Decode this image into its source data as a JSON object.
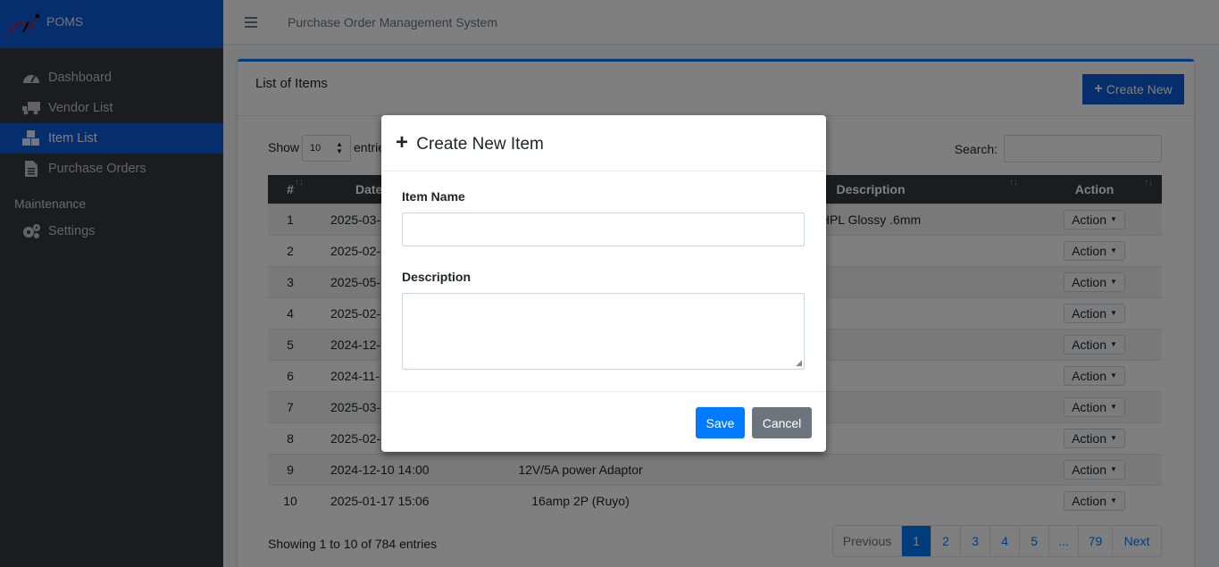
{
  "brand": {
    "name": "POMS"
  },
  "sidebar": {
    "items": [
      {
        "label": "Dashboard",
        "icon": "dashboard-icon"
      },
      {
        "label": "Vendor List",
        "icon": "truck-icon"
      },
      {
        "label": "Item List",
        "icon": "boxes-icon"
      },
      {
        "label": "Purchase Orders",
        "icon": "document-icon"
      }
    ],
    "section_header": "Maintenance",
    "section_items": [
      {
        "label": "Settings",
        "icon": "gears-icon"
      }
    ]
  },
  "header": {
    "title": "Purchase Order Management System"
  },
  "card": {
    "title": "List of Items",
    "create_button": "Create New"
  },
  "controls": {
    "show_label": "Show",
    "entries_value": "10",
    "entries_label": "entries",
    "search_label": "Search:"
  },
  "table": {
    "columns": [
      "#",
      "Date C",
      "Description",
      "Action"
    ],
    "rows": [
      {
        "num": "1",
        "date": "2025-03-",
        "name": "",
        "description": "HPL Glossy .6mm",
        "action": "Action"
      },
      {
        "num": "2",
        "date": "2025-02-",
        "name": "",
        "description": "",
        "action": "Action"
      },
      {
        "num": "3",
        "date": "2025-05-",
        "name": "",
        "description": "",
        "action": "Action"
      },
      {
        "num": "4",
        "date": "2025-02-",
        "name": "",
        "description": "",
        "action": "Action"
      },
      {
        "num": "5",
        "date": "2024-12-",
        "name": "",
        "description": "",
        "action": "Action"
      },
      {
        "num": "6",
        "date": "2024-11-",
        "name": "",
        "description": "",
        "action": "Action"
      },
      {
        "num": "7",
        "date": "2025-03-",
        "name": "",
        "description": "",
        "action": "Action"
      },
      {
        "num": "8",
        "date": "2025-02-",
        "name": "",
        "description": "",
        "action": "Action"
      },
      {
        "num": "9",
        "date": "2024-12-10 14:00",
        "name": "12V/5A power Adaptor",
        "description": "",
        "action": "Action"
      },
      {
        "num": "10",
        "date": "2025-01-17 15:06",
        "name": "16amp 2P (Ruyo)",
        "description": "",
        "action": "Action"
      }
    ]
  },
  "footer": {
    "showing": "Showing 1 to 10 of 784 entries"
  },
  "pagination": {
    "pages": [
      "Previous",
      "1",
      "2",
      "3",
      "4",
      "5",
      "...",
      "79",
      "Next"
    ]
  },
  "modal": {
    "title": "Create New Item",
    "item_name_label": "Item Name",
    "item_name_value": "",
    "description_label": "Description",
    "description_value": "",
    "save_label": "Save",
    "cancel_label": "Cancel"
  },
  "colors": {
    "brand": "#0d5bd8",
    "sidebar": "#343a40",
    "primary": "#007bff",
    "secondary": "#6c757d"
  }
}
